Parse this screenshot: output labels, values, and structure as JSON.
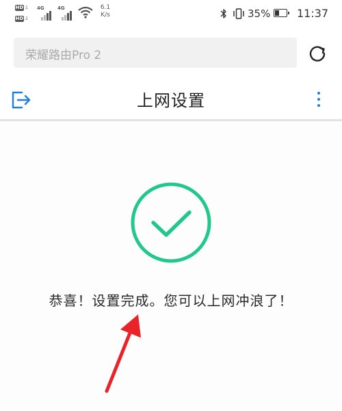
{
  "status_bar": {
    "sim1_badge": "HD",
    "sim1_num": "1",
    "sim2_badge": "HD",
    "sim2_num": "2",
    "signal1_type": "4G",
    "signal2_type": "4G",
    "net_speed_value": "6.1",
    "net_speed_unit": "K/s",
    "battery_percent": "35%",
    "battery_level": 0.35,
    "time": "11:37",
    "icons": [
      "hd-icon",
      "signal-icon",
      "wifi-icon",
      "bluetooth-icon",
      "vibrate-icon",
      "battery-icon"
    ]
  },
  "search": {
    "text": "荣耀路由Pro 2",
    "refresh_icon": "refresh-icon"
  },
  "header": {
    "title": "上网设置",
    "left_icon": "exit-icon",
    "right_icon": "more-vertical-icon"
  },
  "main": {
    "success_icon": "check-circle-icon",
    "message": "恭喜！设置完成。您可以上网冲浪了！",
    "annotation_icon": "red-arrow-icon"
  },
  "colors": {
    "accent": "#1f7fe0",
    "success": "#22c88a",
    "annotation": "#e8232a",
    "search_bg": "#f1f1f1"
  }
}
